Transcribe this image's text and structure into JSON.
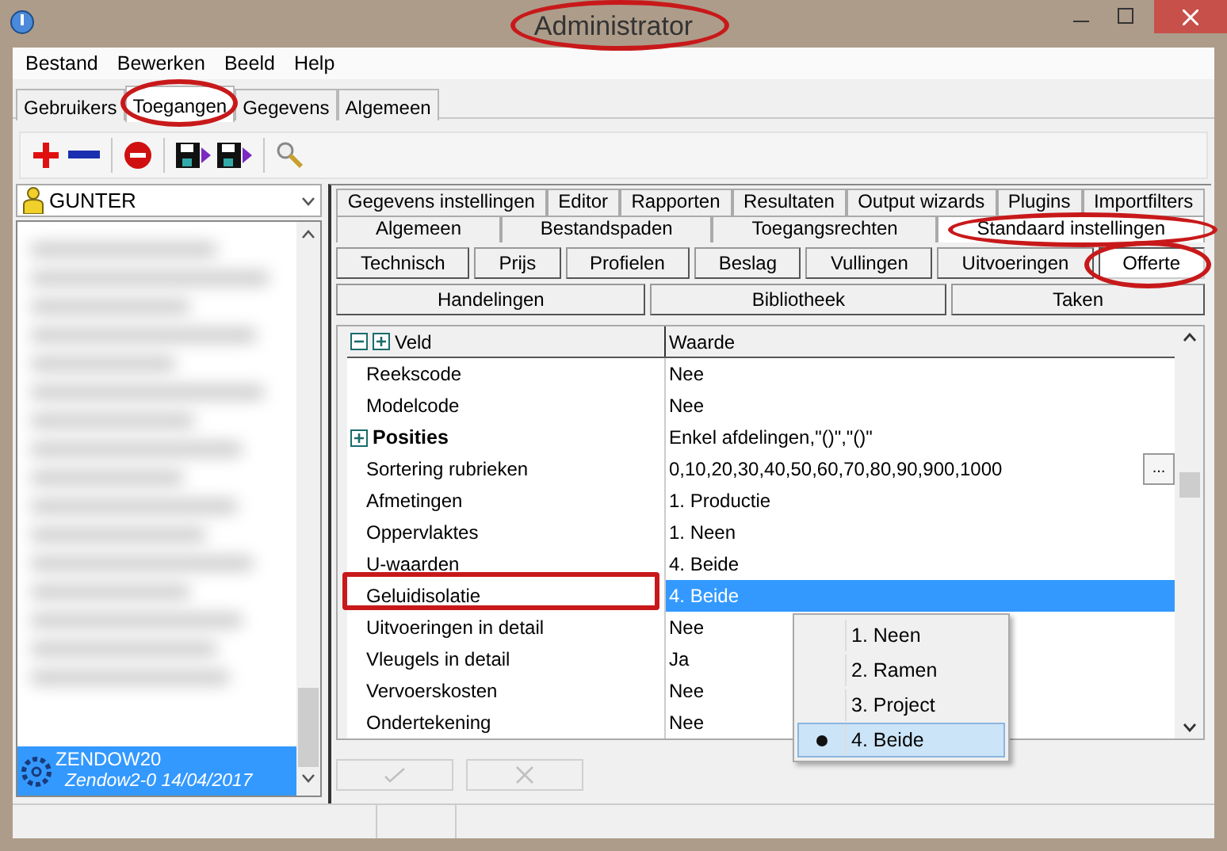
{
  "window": {
    "title": "Administrator"
  },
  "menu": [
    "Bestand",
    "Bewerken",
    "Beeld",
    "Help"
  ],
  "main_tabs": [
    {
      "label": "Gebruikers",
      "selected": false
    },
    {
      "label": "Toegangen",
      "selected": true
    },
    {
      "label": "Gegevens",
      "selected": false
    },
    {
      "label": "Algemeen",
      "selected": false
    }
  ],
  "user_select": {
    "value": "GUNTER"
  },
  "user_list": {
    "items": [
      {
        "name": "ZENDOW20",
        "detail": "Zendow2-0 14/04/2017",
        "selected": true
      }
    ]
  },
  "settings_tabs": [
    [
      {
        "label": "Gegevens instellingen",
        "selected": false
      },
      {
        "label": "Editor",
        "selected": false
      },
      {
        "label": "Rapporten",
        "selected": false
      },
      {
        "label": "Resultaten",
        "selected": false
      },
      {
        "label": "Output wizards",
        "selected": false
      },
      {
        "label": "Plugins",
        "selected": false
      },
      {
        "label": "Importfilters",
        "selected": false
      }
    ],
    [
      {
        "label": "Algemeen",
        "selected": false
      },
      {
        "label": "Bestandspaden",
        "selected": false
      },
      {
        "label": "Toegangsrechten",
        "selected": false
      },
      {
        "label": "Standaard instellingen",
        "selected": true
      }
    ]
  ],
  "category_buttons": [
    [
      {
        "label": "Technisch",
        "selected": false
      },
      {
        "label": "Prijs",
        "selected": false
      },
      {
        "label": "Profielen",
        "selected": false
      },
      {
        "label": "Beslag",
        "selected": false
      },
      {
        "label": "Vullingen",
        "selected": false
      },
      {
        "label": "Uitvoeringen",
        "selected": false
      },
      {
        "label": "Offerte",
        "selected": true
      }
    ],
    [
      {
        "label": "Handelingen",
        "selected": false
      },
      {
        "label": "Bibliotheek",
        "selected": false
      },
      {
        "label": "Taken",
        "selected": false
      }
    ]
  ],
  "grid": {
    "columns": [
      "Veld",
      "Waarde"
    ],
    "rows": [
      {
        "field": "Reekscode",
        "value": "Nee",
        "kind": "plain",
        "selected": false
      },
      {
        "field": "Modelcode",
        "value": "Nee",
        "kind": "plain",
        "selected": false
      },
      {
        "field": "Posities",
        "value": "Enkel afdelingen,\"()\",\"()\"",
        "kind": "group",
        "selected": false
      },
      {
        "field": "Sortering rubrieken",
        "value": "0,10,20,30,40,50,60,70,80,90,900,1000",
        "kind": "ellipsis",
        "button": "...",
        "selected": false
      },
      {
        "field": "Afmetingen",
        "value": "1. Productie",
        "kind": "plain",
        "selected": false
      },
      {
        "field": "Oppervlaktes",
        "value": "1. Neen",
        "kind": "plain",
        "selected": false
      },
      {
        "field": "U-waarden",
        "value": "4. Beide",
        "kind": "plain",
        "selected": false
      },
      {
        "field": "Geluidisolatie",
        "value": "4. Beide",
        "kind": "plain",
        "selected": true
      },
      {
        "field": "Uitvoeringen in detail",
        "value": "Nee",
        "kind": "plain",
        "selected": false
      },
      {
        "field": "Vleugels in detail",
        "value": "Ja",
        "kind": "plain",
        "selected": false
      },
      {
        "field": "Vervoerskosten",
        "value": "Nee",
        "kind": "plain",
        "selected": false
      },
      {
        "field": "Ondertekening",
        "value": "Nee",
        "kind": "plain",
        "selected": false
      }
    ]
  },
  "dropdown": {
    "options": [
      {
        "label": "1. Neen",
        "selected": false
      },
      {
        "label": "2. Ramen",
        "selected": false
      },
      {
        "label": "3. Project",
        "selected": false
      },
      {
        "label": "4. Beide",
        "selected": true
      }
    ]
  }
}
